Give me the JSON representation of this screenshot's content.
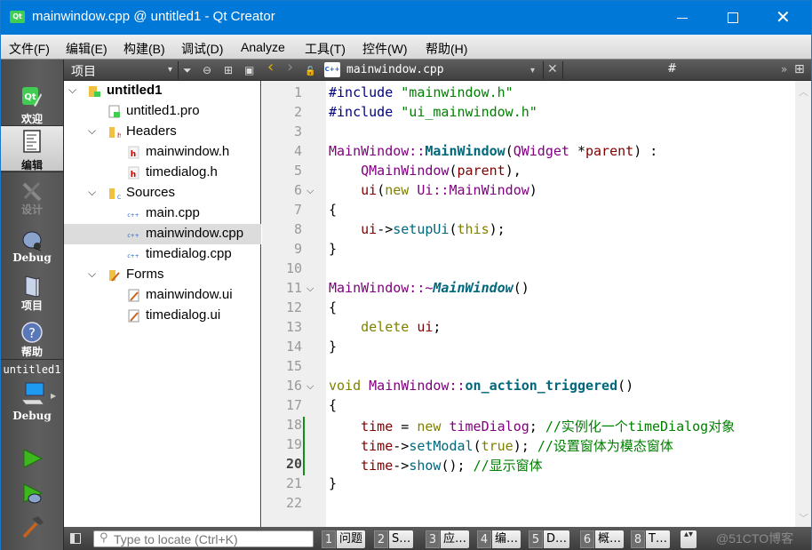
{
  "window": {
    "title": "mainwindow.cpp @ untitled1 - Qt Creator",
    "app_icon": "qt-logo-icon",
    "controls": {
      "minimize": "minimize-icon",
      "maximize": "maximize-icon",
      "close": "close-icon",
      "close_glyph": "✕"
    }
  },
  "menu": [
    {
      "label": "文件(F)"
    },
    {
      "label": "编辑(E)"
    },
    {
      "label": "构建(B)"
    },
    {
      "label": "调试(D)"
    },
    {
      "label": "Analyze"
    },
    {
      "label": "工具(T)"
    },
    {
      "label": "控件(W)"
    },
    {
      "label": "帮助(H)"
    }
  ],
  "modes": [
    {
      "label": "欢迎",
      "icon": "qt-welcome-icon",
      "state": "normal"
    },
    {
      "label": "编辑",
      "icon": "edit-document-icon",
      "state": "active"
    },
    {
      "label": "设计",
      "icon": "design-icon",
      "state": "disabled"
    },
    {
      "label": "Debug",
      "icon": "debug-bug-icon",
      "state": "normal"
    },
    {
      "label": "项目",
      "icon": "project-book-icon",
      "state": "normal"
    },
    {
      "label": "帮助",
      "icon": "help-icon",
      "state": "normal"
    }
  ],
  "kit_selector": {
    "project": "untitled1",
    "build_config": "Debug",
    "icon": "monitor-icon"
  },
  "run_actions": {
    "run": "run-icon",
    "debug_run": "debug-run-icon",
    "build": "build-hammer-icon"
  },
  "project_pane": {
    "title": "项目",
    "glyphs": {
      "dropdown": "▾",
      "filter": "⏷",
      "link": "⊖",
      "split": "⊞",
      "close": "▣"
    },
    "tree": [
      {
        "label": "untitled1",
        "level": 0,
        "expanded": true,
        "bold": true,
        "icon": "qt-project-folder-icon"
      },
      {
        "label": "untitled1.pro",
        "level": 1,
        "icon": "pro-file-icon"
      },
      {
        "label": "Headers",
        "level": 1,
        "expanded": true,
        "icon": "headers-folder-icon"
      },
      {
        "label": "mainwindow.h",
        "level": 2,
        "icon": "header-file-icon"
      },
      {
        "label": "timedialog.h",
        "level": 2,
        "icon": "header-file-icon"
      },
      {
        "label": "Sources",
        "level": 1,
        "expanded": true,
        "icon": "sources-folder-icon"
      },
      {
        "label": "main.cpp",
        "level": 2,
        "icon": "cpp-file-icon"
      },
      {
        "label": "mainwindow.cpp",
        "level": 2,
        "icon": "cpp-file-icon",
        "selected": true
      },
      {
        "label": "timedialog.cpp",
        "level": 2,
        "icon": "cpp-file-icon"
      },
      {
        "label": "Forms",
        "level": 1,
        "expanded": true,
        "icon": "forms-folder-icon"
      },
      {
        "label": "mainwindow.ui",
        "level": 2,
        "icon": "ui-file-icon"
      },
      {
        "label": "timedialog.ui",
        "level": 2,
        "icon": "ui-file-icon"
      }
    ]
  },
  "editor_toolbar": {
    "file_name": "mainwindow.cpp",
    "symbol": "#",
    "glyphs": {
      "back": "‹",
      "forward": "›",
      "lock": "🔓",
      "dropdown": "▾",
      "close": "✕",
      "overflow": "»",
      "split": "⊞",
      "cpp_badge": "C++"
    }
  },
  "editor": {
    "current_line": 20,
    "lines": [
      {
        "n": 1,
        "tokens": [
          [
            "pp",
            "#include "
          ],
          [
            "str",
            "\"mainwindow.h\""
          ]
        ]
      },
      {
        "n": 2,
        "tokens": [
          [
            "pp",
            "#include "
          ],
          [
            "str",
            "\"ui_mainwindow.h\""
          ]
        ]
      },
      {
        "n": 3,
        "tokens": []
      },
      {
        "n": 4,
        "tokens": [
          [
            "type",
            "MainWindow::"
          ],
          [
            "fn",
            "MainWindow"
          ],
          [
            "",
            "("
          ],
          [
            "type",
            "QWidget"
          ],
          [
            "",
            " *"
          ],
          [
            "var",
            "parent"
          ],
          [
            "",
            ") :"
          ]
        ]
      },
      {
        "n": 5,
        "tokens": [
          [
            "",
            "    "
          ],
          [
            "type",
            "QMainWindow"
          ],
          [
            "",
            "("
          ],
          [
            "var",
            "parent"
          ],
          [
            "",
            "),"
          ]
        ]
      },
      {
        "n": 6,
        "fold": true,
        "tokens": [
          [
            "",
            "    "
          ],
          [
            "var",
            "ui"
          ],
          [
            "",
            "("
          ],
          [
            "kw",
            "new "
          ],
          [
            "type",
            "Ui::MainWindow"
          ],
          [
            "",
            ")"
          ]
        ]
      },
      {
        "n": 7,
        "tokens": [
          [
            "",
            "{"
          ]
        ]
      },
      {
        "n": 8,
        "tokens": [
          [
            "",
            "    "
          ],
          [
            "var",
            "ui"
          ],
          [
            "",
            "->"
          ],
          [
            "call",
            "setupUi"
          ],
          [
            "",
            "("
          ],
          [
            "kw",
            "this"
          ],
          [
            "",
            ");"
          ]
        ]
      },
      {
        "n": 9,
        "tokens": [
          [
            "",
            "}"
          ]
        ]
      },
      {
        "n": 10,
        "tokens": []
      },
      {
        "n": 11,
        "fold": true,
        "tokens": [
          [
            "type",
            "MainWindow::~"
          ],
          [
            "fni",
            "MainWindow"
          ],
          [
            "",
            "()"
          ]
        ]
      },
      {
        "n": 12,
        "tokens": [
          [
            "",
            "{"
          ]
        ]
      },
      {
        "n": 13,
        "tokens": [
          [
            "",
            "    "
          ],
          [
            "kw",
            "delete "
          ],
          [
            "var",
            "ui"
          ],
          [
            "",
            ";"
          ]
        ]
      },
      {
        "n": 14,
        "tokens": [
          [
            "",
            "}"
          ]
        ]
      },
      {
        "n": 15,
        "tokens": []
      },
      {
        "n": 16,
        "fold": true,
        "tokens": [
          [
            "kw",
            "void "
          ],
          [
            "type",
            "MainWindow::"
          ],
          [
            "fn",
            "on_action_triggered"
          ],
          [
            "",
            "()"
          ]
        ]
      },
      {
        "n": 17,
        "tokens": [
          [
            "",
            "{"
          ]
        ]
      },
      {
        "n": 18,
        "modified": true,
        "tokens": [
          [
            "",
            "    "
          ],
          [
            "var",
            "time"
          ],
          [
            "",
            " = "
          ],
          [
            "kw",
            "new "
          ],
          [
            "type",
            "timeDialog"
          ],
          [
            "",
            "; "
          ],
          [
            "cm",
            "//实例化一个timeDialog对象"
          ]
        ]
      },
      {
        "n": 19,
        "modified": true,
        "tokens": [
          [
            "",
            "    "
          ],
          [
            "var",
            "time"
          ],
          [
            "",
            "->"
          ],
          [
            "call",
            "setModal"
          ],
          [
            "",
            "("
          ],
          [
            "kw",
            "true"
          ],
          [
            "",
            "); "
          ],
          [
            "cm",
            "//设置窗体为模态窗体"
          ]
        ]
      },
      {
        "n": 20,
        "modified": true,
        "tokens": [
          [
            "",
            "    "
          ],
          [
            "var",
            "time"
          ],
          [
            "",
            "->"
          ],
          [
            "call",
            "show"
          ],
          [
            "",
            "(); "
          ],
          [
            "cm",
            "//显示窗体"
          ]
        ]
      },
      {
        "n": 21,
        "tokens": [
          [
            "",
            "}"
          ]
        ]
      },
      {
        "n": 22,
        "tokens": []
      }
    ]
  },
  "scrollbar": {
    "up": "︿",
    "down": "﹀"
  },
  "statusbar": {
    "locator_placeholder": "Type to locate (Ctrl+K)",
    "search_glyph": "⚲",
    "output_tabs": [
      {
        "num": "1",
        "label": "问题"
      },
      {
        "num": "2",
        "label": "S…"
      },
      {
        "num": "3",
        "label": "应…"
      },
      {
        "num": "4",
        "label": "编…"
      },
      {
        "num": "5",
        "label": "D…"
      },
      {
        "num": "6",
        "label": "概…"
      },
      {
        "num": "8",
        "label": "T…"
      }
    ],
    "spin_glyph": "▴▾",
    "watermark": "@51CTO博客"
  }
}
